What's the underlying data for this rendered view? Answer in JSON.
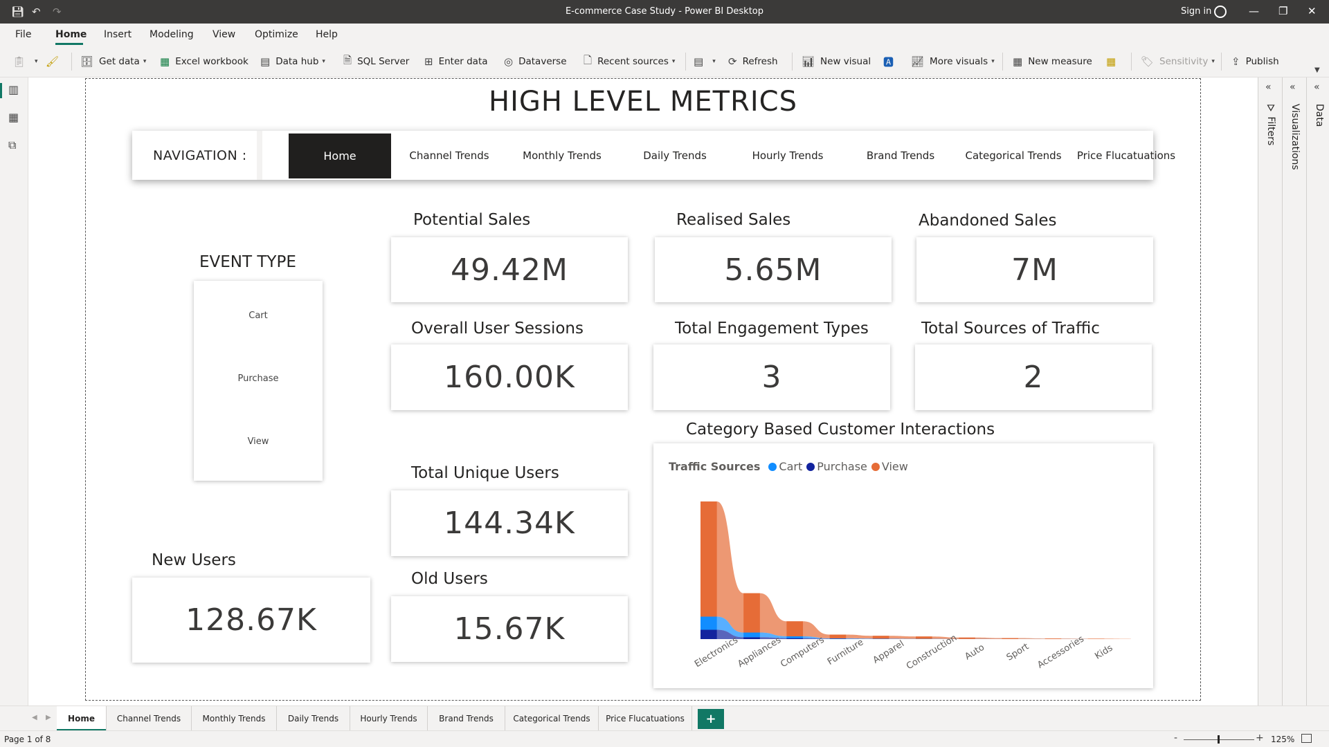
{
  "window": {
    "title": "E-commerce Case Study - Power BI Desktop",
    "sign_in": "Sign in",
    "minimize": "—",
    "restore": "❐",
    "close": "✕"
  },
  "menu": {
    "file": "File",
    "home": "Home",
    "insert": "Insert",
    "modeling": "Modeling",
    "view": "View",
    "optimize": "Optimize",
    "help": "Help"
  },
  "ribbon": {
    "get_data": "Get data",
    "excel_workbook": "Excel workbook",
    "data_hub": "Data hub",
    "sql_server": "SQL Server",
    "enter_data": "Enter data",
    "dataverse": "Dataverse",
    "recent_sources": "Recent sources",
    "refresh": "Refresh",
    "new_visual": "New visual",
    "more_visuals": "More visuals",
    "new_measure": "New measure",
    "sensitivity": "Sensitivity",
    "publish": "Publish"
  },
  "report": {
    "title": "HIGH LEVEL METRICS",
    "nav_label": "NAVIGATION :",
    "nav_buttons": [
      "Home",
      "Channel Trends",
      "Monthly Trends",
      "Daily Trends",
      "Hourly Trends",
      "Brand Trends",
      "Categorical Trends",
      "Price Flucatuations"
    ]
  },
  "cards": {
    "potential_sales": {
      "title": "Potential Sales",
      "value": "49.42M"
    },
    "realised_sales": {
      "title": "Realised Sales",
      "value": "5.65M"
    },
    "abandoned_sales": {
      "title": "Abandoned Sales",
      "value": "7M"
    },
    "overall_user_sessions": {
      "title": "Overall User Sessions",
      "value": "160.00K"
    },
    "total_engagement_types": {
      "title": "Total Engagement Types",
      "value": "3"
    },
    "total_sources_of_traffic": {
      "title": "Total Sources of Traffic",
      "value": "2"
    },
    "total_unique_users": {
      "title": "Total Unique Users",
      "value": "144.34K"
    },
    "old_users": {
      "title": "Old Users",
      "value": "15.67K"
    },
    "new_users": {
      "title": "New Users",
      "value": "128.67K"
    }
  },
  "slicer": {
    "title": "EVENT TYPE",
    "items": [
      "Cart",
      "Purchase",
      "View"
    ]
  },
  "chart_data": {
    "type": "area",
    "title": "Category Based Customer Interactions",
    "legend_title": "Traffic Sources",
    "legend_position": "top-left",
    "categories": [
      "Electronics",
      "Appliances",
      "Computers",
      "Furniture",
      "Apparel",
      "Construction",
      "Auto",
      "Sport",
      "Accessories",
      "Kids"
    ],
    "series": [
      {
        "name": "Cart",
        "color": "#118dff",
        "values": [
          14,
          5,
          2,
          0.5,
          0.3,
          0.2,
          0.1,
          0.05,
          0.03,
          0.02
        ]
      },
      {
        "name": "Purchase",
        "color": "#12239e",
        "values": [
          10,
          2,
          1,
          0.3,
          0.2,
          0.1,
          0.05,
          0.03,
          0.02,
          0.01
        ]
      },
      {
        "name": "View",
        "color": "#e66c37",
        "values": [
          123,
          42,
          16,
          4,
          3,
          2.5,
          1.5,
          1,
          0.6,
          0.4
        ]
      }
    ],
    "ylim": [
      0,
      150
    ],
    "grid": false
  },
  "tabs": [
    "Home",
    "Channel Trends",
    "Monthly Trends",
    "Daily Trends",
    "Hourly Trends",
    "Brand Trends",
    "Categorical Trends",
    "Price Flucatuations"
  ],
  "add_tab": "+",
  "status": {
    "page_info": "Page 1 of 8",
    "zoom": "125%",
    "zoom_minus": "-",
    "zoom_plus": "+"
  },
  "panes": {
    "filters": "Filters",
    "visualizations": "Visualizations",
    "data": "Data"
  }
}
